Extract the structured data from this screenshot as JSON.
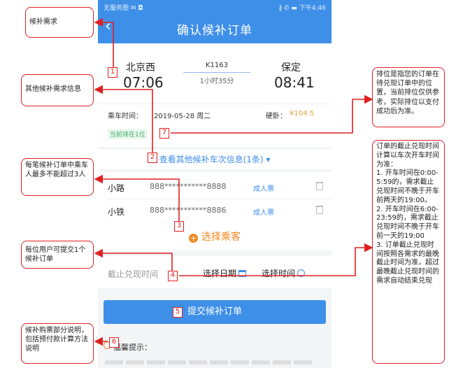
{
  "phone": {
    "status_left": "无服务图 ✉ ◘",
    "status_right": "∦ ✆ ▬ 下午4:46",
    "back_glyph": "‹",
    "title": "确认候补订单"
  },
  "train": {
    "from_station": "北京西",
    "from_time": "07:06",
    "train_no": "K1163",
    "duration": "1小时35分",
    "to_station": "保定",
    "to_time": "08:41",
    "date_label": "乘车时间：",
    "date_value": "2019-05-28 周二",
    "price_label": "硬卧：",
    "price_value": "¥104.5",
    "queue_text": "当前排在1位"
  },
  "more_info": {
    "label": "查看其他候补车次信息(1条) ▾"
  },
  "passengers": [
    {
      "name": "小路",
      "id": "888***********8888",
      "type": "成人票"
    },
    {
      "name": "小铁",
      "id": "888***********8886",
      "type": "成人票"
    }
  ],
  "choose_passenger": {
    "label": "选择乘客",
    "plus": "+"
  },
  "deadline": {
    "label": "截止兑现时间",
    "date_label": "选择日期",
    "time_label": "选择时间"
  },
  "submit": {
    "label": "提交候补订单"
  },
  "tips": {
    "title": "温馨提示："
  },
  "annotations": {
    "n1": "候补需求",
    "n2": "其他候补需求信息",
    "n3": "每笔候补订单中乘车人最多不能超过3人",
    "n4": "每位用户可提交1个候补订单",
    "n5": "候补购票部分说明，包括预付款计算方法说明",
    "n6": "排位是指您的订单在待兑现订单中的位置，当前排位仅供参考，实际排位以支付成功后为准。",
    "n7": "订单的截止兑现时间计算以车次开车时间为准：\n1. 开车时间在0:00-5:59的，需求截止兑现时间不晚于开车前两天的19:00。\n2. 开车时间在6:00-23:59的，需求截止兑现时间不晚于开车前一天的19:00\n3. 订单截止兑现时间按照各需求的最晚截止时间为准，超过最晚截止兑现时间的需求自动结束兑现"
  },
  "markers": [
    "1",
    "2",
    "3",
    "4",
    "5",
    "6",
    "7"
  ],
  "colors": {
    "accent": "#3e8fe8",
    "annotation": "#e02020",
    "price": "#e6a23c",
    "queue": "#43b36a",
    "choose": "#f08a24"
  }
}
